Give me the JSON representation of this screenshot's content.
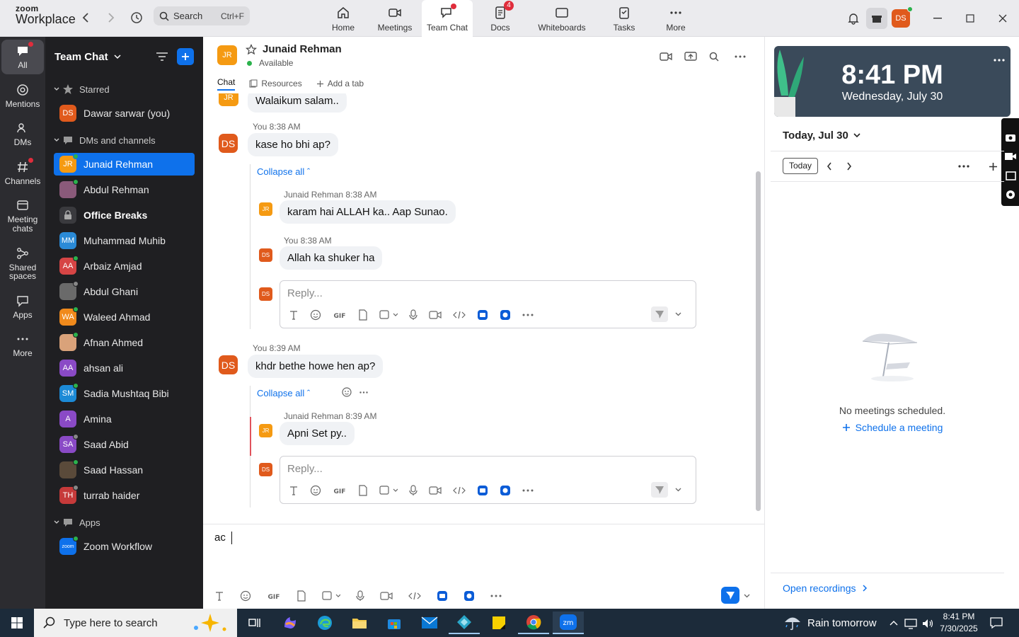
{
  "app": {
    "logo_top": "zoom",
    "logo_bottom": "Workplace"
  },
  "search": {
    "label": "Search",
    "shortcut": "Ctrl+F"
  },
  "nav_tabs": [
    {
      "label": "Home",
      "icon": "home-icon"
    },
    {
      "label": "Meetings",
      "icon": "video-icon"
    },
    {
      "label": "Team Chat",
      "icon": "chat-icon",
      "active": true,
      "dot": true
    },
    {
      "label": "Docs",
      "icon": "docs-icon",
      "badge": "4"
    },
    {
      "label": "Whiteboards",
      "icon": "whiteboard-icon"
    },
    {
      "label": "Tasks",
      "icon": "tasks-icon"
    },
    {
      "label": "More",
      "icon": "more-icon"
    }
  ],
  "user": {
    "initials": "DS",
    "color": "#e05a1c"
  },
  "rail": [
    {
      "label": "All",
      "active": true
    },
    {
      "label": "Mentions"
    },
    {
      "label": "DMs"
    },
    {
      "label": "Channels",
      "dot": true
    },
    {
      "label_1": "Meeting",
      "label_2": "chats"
    },
    {
      "label_1": "Shared",
      "label_2": "spaces"
    },
    {
      "label": "Apps"
    },
    {
      "label": "More"
    }
  ],
  "sidebar": {
    "title": "Team Chat",
    "starred_label": "Starred",
    "starred": [
      {
        "name": "Dawar sarwar (you)",
        "initials": "DS",
        "color": "#e05a1c"
      }
    ],
    "dms_label": "DMs and channels",
    "dms": [
      {
        "name": "Junaid Rehman",
        "initials": "JR",
        "color": "#f59a12",
        "presence": "#2bb24c",
        "active": true
      },
      {
        "name": "Abdul Rehman",
        "initials": "",
        "color": "#8a5a7a",
        "presence": "#2bb24c"
      },
      {
        "name": "Office Breaks",
        "initials": "",
        "color": "#3a3a3e",
        "bold": true
      },
      {
        "name": "Muhammad Muhib",
        "initials": "MM",
        "color": "#2a8ad6"
      },
      {
        "name": "Arbaiz Amjad",
        "initials": "AA",
        "color": "#d64545",
        "presence": "#2bb24c"
      },
      {
        "name": "Abdul Ghani",
        "initials": "",
        "color": "#6a6a6a",
        "presence": "#888"
      },
      {
        "name": "Waleed Ahmad",
        "initials": "WA",
        "color": "#f08a1c",
        "presence": "#2bb24c"
      },
      {
        "name": "Afnan Ahmed",
        "initials": "",
        "color": "#d9a27a",
        "presence": "#2bb24c"
      },
      {
        "name": "ahsan ali",
        "initials": "AA",
        "color": "#8a4ac6"
      },
      {
        "name": "Sadia Mushtaq Bibi",
        "initials": "SM",
        "color": "#1c8ad6",
        "presence": "#2bb24c"
      },
      {
        "name": "Amina",
        "initials": "A",
        "color": "#8a4ac6"
      },
      {
        "name": "Saad Abid",
        "initials": "SA",
        "color": "#8a4ac6",
        "presence": "#888"
      },
      {
        "name": "Saad Hassan",
        "initials": "",
        "color": "#5a4a3a",
        "presence": "#2bb24c"
      },
      {
        "name": "turrab haider",
        "initials": "TH",
        "color": "#c63a3a",
        "presence": "#888"
      }
    ],
    "apps_label": "Apps",
    "apps": [
      {
        "name": "Zoom Workflow",
        "initials": "zoom",
        "color": "#0e71eb",
        "presence": "#2bb24c"
      }
    ]
  },
  "chat": {
    "contact": "Junaid Rehman",
    "contact_initials": "JR",
    "status": "Available",
    "tabs": [
      "Chat",
      "Resources",
      "Add a tab"
    ],
    "messages": {
      "m0": "Walaikum salam..",
      "m1_meta": "You 8:38 AM",
      "m1": "kase ho bhi ap?",
      "collapse": "Collapse all",
      "r1_author": "Junaid Rehman",
      "r1_time": "8:38 AM",
      "r1": "karam hai ALLAH ka.. Aap Sunao.",
      "r2_meta": "You 8:38 AM",
      "r2": "Allah ka shuker ha",
      "reply_ph": "Reply...",
      "m2_meta": "You 8:39 AM",
      "m2": "khdr bethe howe hen ap?",
      "r3_author": "Junaid Rehman",
      "r3_time": "8:39 AM",
      "r3": "Apni Set py.."
    },
    "me_initials": "DS",
    "compose_text": "ac"
  },
  "calendar": {
    "time": "8:41 PM",
    "date": "Wednesday, July 30",
    "today_heading": "Today, Jul 30",
    "today_button": "Today",
    "empty": "No meetings scheduled.",
    "schedule": "Schedule a meeting",
    "recordings": "Open recordings"
  },
  "taskbar": {
    "search_ph": "Type here to search",
    "weather": "Rain tomorrow",
    "time": "8:41 PM",
    "date": "7/30/2025"
  }
}
